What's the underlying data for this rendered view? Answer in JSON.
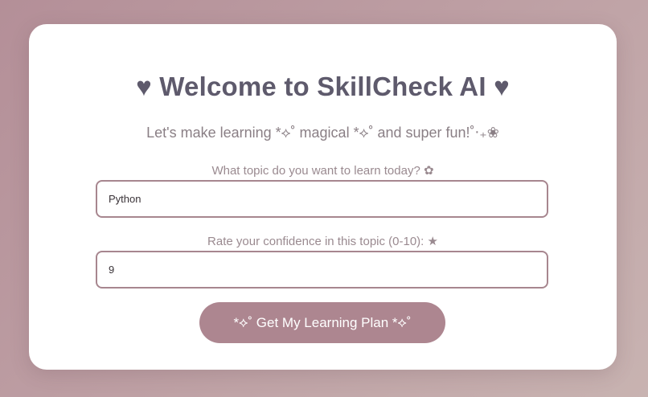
{
  "card": {
    "title": "♥ Welcome to SkillCheck AI ♥",
    "subtitle": "Let's make learning *⟡˚ magical *⟡˚ and super fun!˚‧₊❀"
  },
  "form": {
    "topic_label": "What topic do you want to learn today? ✿",
    "topic_value": "Python",
    "confidence_label": "Rate your confidence in this topic (0-10): ★",
    "confidence_value": "9",
    "submit_label": "*⟡˚ Get My Learning Plan *⟡˚"
  },
  "colors": {
    "accent": "#ad8690",
    "title": "#5e5a6c",
    "border": "#a7868f"
  }
}
